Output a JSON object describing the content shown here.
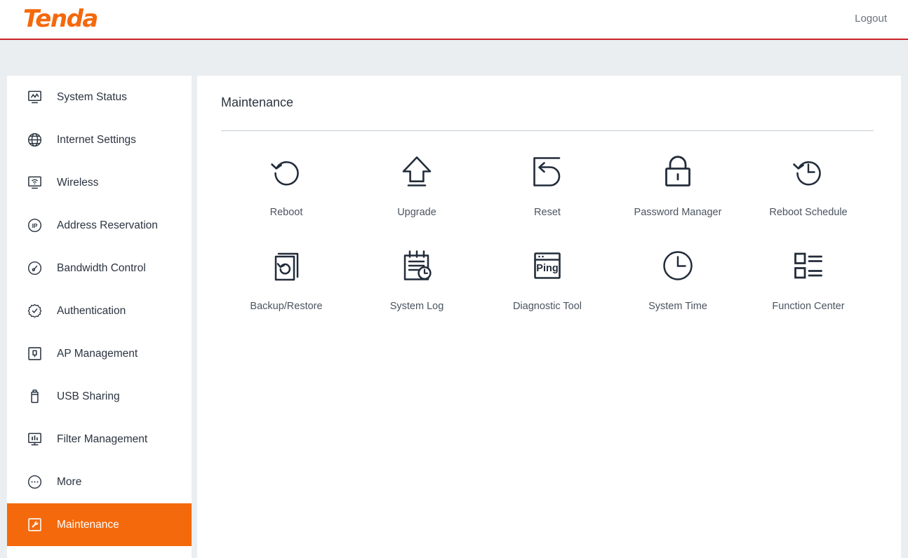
{
  "header": {
    "logo_text": "Tenda",
    "logout_label": "Logout",
    "brand_color": "#f4690c",
    "accent_rule_color": "#cc2229"
  },
  "sidebar": {
    "active_item": "Maintenance",
    "active_bg_color": "#f4690c",
    "items": [
      {
        "label": "System Status",
        "icon": "monitor-chart-icon",
        "active": false
      },
      {
        "label": "Internet Settings",
        "icon": "globe-icon",
        "active": false
      },
      {
        "label": "Wireless",
        "icon": "monitor-wifi-icon",
        "active": false
      },
      {
        "label": "Address Reservation",
        "icon": "ip-circle-icon",
        "active": false
      },
      {
        "label": "Bandwidth Control",
        "icon": "gauge-icon",
        "active": false
      },
      {
        "label": "Authentication",
        "icon": "badge-check-icon",
        "active": false
      },
      {
        "label": "AP Management",
        "icon": "access-point-icon",
        "active": false
      },
      {
        "label": "USB Sharing",
        "icon": "usb-drive-icon",
        "active": false
      },
      {
        "label": "Filter Management",
        "icon": "filter-chart-icon",
        "active": false
      },
      {
        "label": "More",
        "icon": "ellipsis-circle-icon",
        "active": false
      },
      {
        "label": "Maintenance",
        "icon": "wrench-square-icon",
        "active": true
      }
    ]
  },
  "main": {
    "page_title": "Maintenance",
    "tiles": [
      {
        "label": "Reboot",
        "icon": "refresh-circle-icon"
      },
      {
        "label": "Upgrade",
        "icon": "upload-arrow-icon"
      },
      {
        "label": "Reset",
        "icon": "reset-back-arrow-icon"
      },
      {
        "label": "Password Manager",
        "icon": "padlock-icon"
      },
      {
        "label": "Reboot Schedule",
        "icon": "clock-refresh-icon"
      },
      {
        "label": "Backup/Restore",
        "icon": "documents-restore-icon"
      },
      {
        "label": "System Log",
        "icon": "clipboard-clock-icon"
      },
      {
        "label": "Diagnostic Tool",
        "icon": "ping-window-icon",
        "icon_text": "Ping"
      },
      {
        "label": "System Time",
        "icon": "clock-icon"
      },
      {
        "label": "Function Center",
        "icon": "list-blocks-icon"
      }
    ]
  }
}
